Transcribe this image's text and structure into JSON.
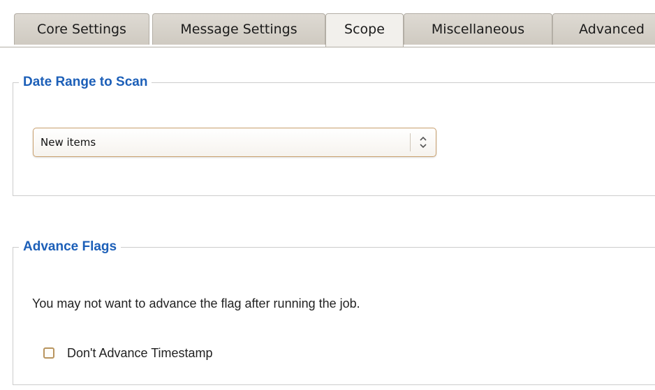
{
  "tabs": [
    {
      "label": "Core Settings",
      "active": false
    },
    {
      "label": "Message Settings",
      "active": false
    },
    {
      "label": "Scope",
      "active": true
    },
    {
      "label": "Miscellaneous",
      "active": false
    },
    {
      "label": "Advanced",
      "active": false
    }
  ],
  "date_range": {
    "legend": "Date Range to Scan",
    "select_value": "New items"
  },
  "advance_flags": {
    "legend": "Advance Flags",
    "description": "You may not want to advance the flag after running the job.",
    "checkbox_label": "Don't Advance Timestamp",
    "checkbox_checked": false
  },
  "colors": {
    "legend": "#1c5fb8",
    "tab_inactive": "#cfcac1",
    "tab_active": "#f2f0ec",
    "select_border": "#c9a06e",
    "checkbox_border": "#b8945e"
  }
}
